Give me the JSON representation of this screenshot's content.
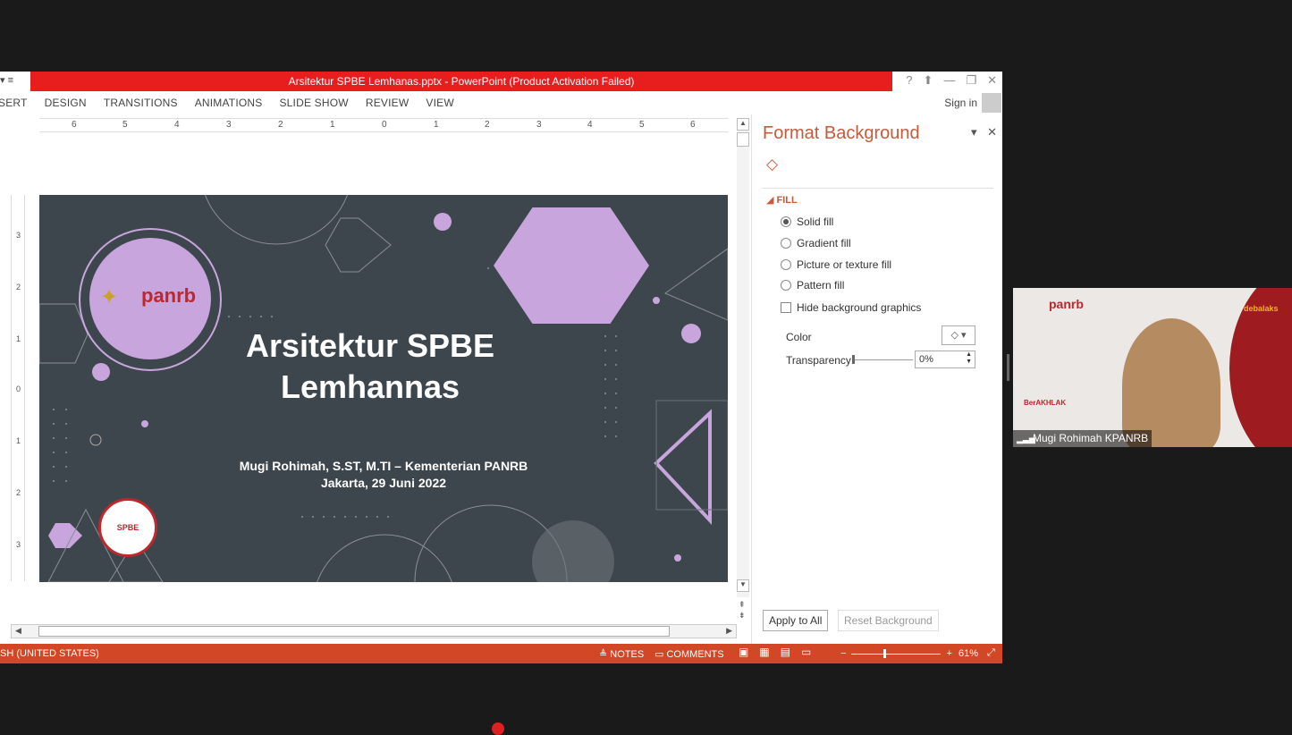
{
  "window": {
    "title": "Arsitektur SPBE Lemhanas.pptx -  PowerPoint (Product Activation Failed)",
    "help": "?",
    "minimize": "—",
    "restore": "❐",
    "close": "✕"
  },
  "ribbon": {
    "tabs": [
      "SERT",
      "DESIGN",
      "TRANSITIONS",
      "ANIMATIONS",
      "SLIDE SHOW",
      "REVIEW",
      "VIEW"
    ],
    "sign_in": "Sign in"
  },
  "ruler": {
    "h_ticks": [
      "6",
      "5",
      "4",
      "3",
      "2",
      "1",
      "0",
      "1",
      "2",
      "3",
      "4",
      "5",
      "6"
    ],
    "v_ticks": [
      "3",
      "2",
      "1",
      "0",
      "1",
      "2",
      "3"
    ]
  },
  "slide": {
    "title_line1": "Arsitektur SPBE",
    "title_line2": "Lemhannas",
    "presenter": "Mugi Rohimah, S.ST, M.TI – Kementerian PANRB",
    "place_date": "Jakarta, 29 Juni 2022",
    "logo_panrb": "panrb",
    "logo_spbe": "SPBE",
    "logo_debalaks": "debalaks"
  },
  "format_panel": {
    "title": "Format Background",
    "section": "FILL",
    "options": [
      {
        "label": "Solid fill",
        "selected": true
      },
      {
        "label": "Gradient fill",
        "selected": false
      },
      {
        "label": "Picture or texture fill",
        "selected": false
      },
      {
        "label": "Pattern fill",
        "selected": false
      }
    ],
    "hide_graphics": "Hide background graphics",
    "color_label": "Color",
    "transparency_label": "Transparency",
    "transparency_value": "0%",
    "transparency_level": 0,
    "apply_all": "Apply to All",
    "reset": "Reset Background"
  },
  "statusbar": {
    "language": "SH (UNITED STATES)",
    "notes": "NOTES",
    "comments": "COMMENTS",
    "zoom": "61%",
    "zoom_minus": "−",
    "zoom_plus": "+"
  },
  "camera": {
    "name": "Mugi Rohimah KPANRB",
    "logo": "panrb",
    "brand": "debalaks",
    "tagline": "BerAKHLAK"
  },
  "colors": {
    "accent": "#d24726",
    "title_bar": "#e81e1e",
    "slide_bg": "#3d464c",
    "lavender": "#c8a5dd"
  }
}
